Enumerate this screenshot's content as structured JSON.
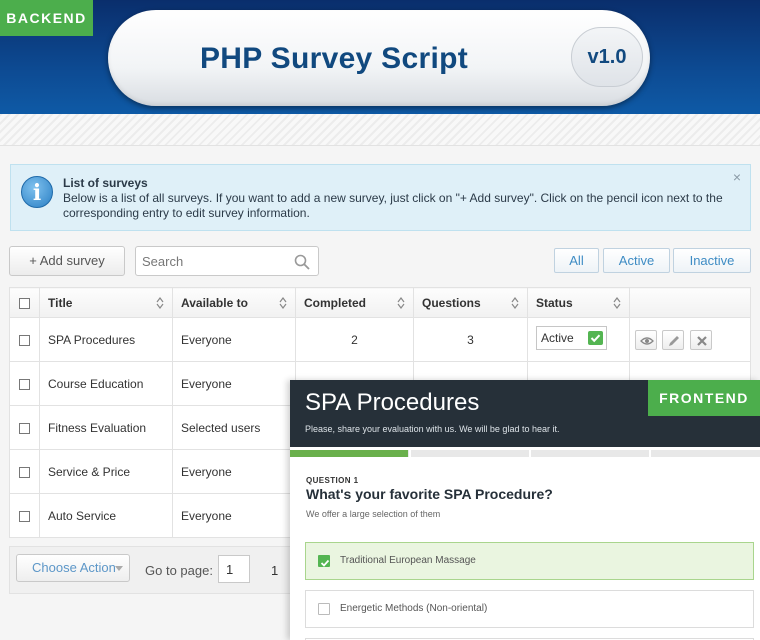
{
  "header": {
    "badge": "BACKEND",
    "title": "PHP Survey Script",
    "version": "v1.0"
  },
  "info": {
    "title": "List of surveys",
    "text": "Below is a list of all surveys. If you want to add a new survey, just click on \"+ Add survey\". Click on the pencil icon next to the corresponding entry to edit survey information.",
    "close": "×"
  },
  "toolbar": {
    "add_label": "+ Add survey",
    "search_placeholder": "Search",
    "filters": [
      "All",
      "Active",
      "Inactive"
    ]
  },
  "table": {
    "columns": [
      "Title",
      "Available to",
      "Completed",
      "Questions",
      "Status"
    ],
    "rows": [
      {
        "title": "SPA Procedures",
        "available_to": "Everyone",
        "completed": "2",
        "questions": "3",
        "status": "Active"
      },
      {
        "title": "Course Education",
        "available_to": "Everyone",
        "completed": "",
        "questions": "",
        "status": ""
      },
      {
        "title": "Fitness Evaluation",
        "available_to": "Selected users",
        "completed": "",
        "questions": "",
        "status": ""
      },
      {
        "title": "Service & Price",
        "available_to": "Everyone",
        "completed": "",
        "questions": "",
        "status": ""
      },
      {
        "title": "Auto Service",
        "available_to": "Everyone",
        "completed": "",
        "questions": "",
        "status": ""
      }
    ]
  },
  "pager": {
    "choose_action": "Choose Action",
    "goto_label": "Go to page:",
    "goto_value": "1",
    "page": "1"
  },
  "frontend": {
    "badge": "FRONTEND",
    "title": "SPA Procedures",
    "subtitle": "Please, share your evaluation with us. We will be glad to hear it.",
    "progress_fraction": 0.25,
    "question_number": "QUESTION 1",
    "question": "What's your favorite SPA Procedure?",
    "hint": "We offer a large selection of them",
    "options": [
      {
        "label": "Traditional European Massage",
        "selected": true
      },
      {
        "label": "Energetic Methods (Non-oriental)",
        "selected": false
      }
    ]
  },
  "colors": {
    "header_blue": "#0d4a92",
    "title_blue": "#11497f",
    "green": "#4cae4c",
    "link_blue": "#3a87c8",
    "frontend_bar": "#263039"
  }
}
